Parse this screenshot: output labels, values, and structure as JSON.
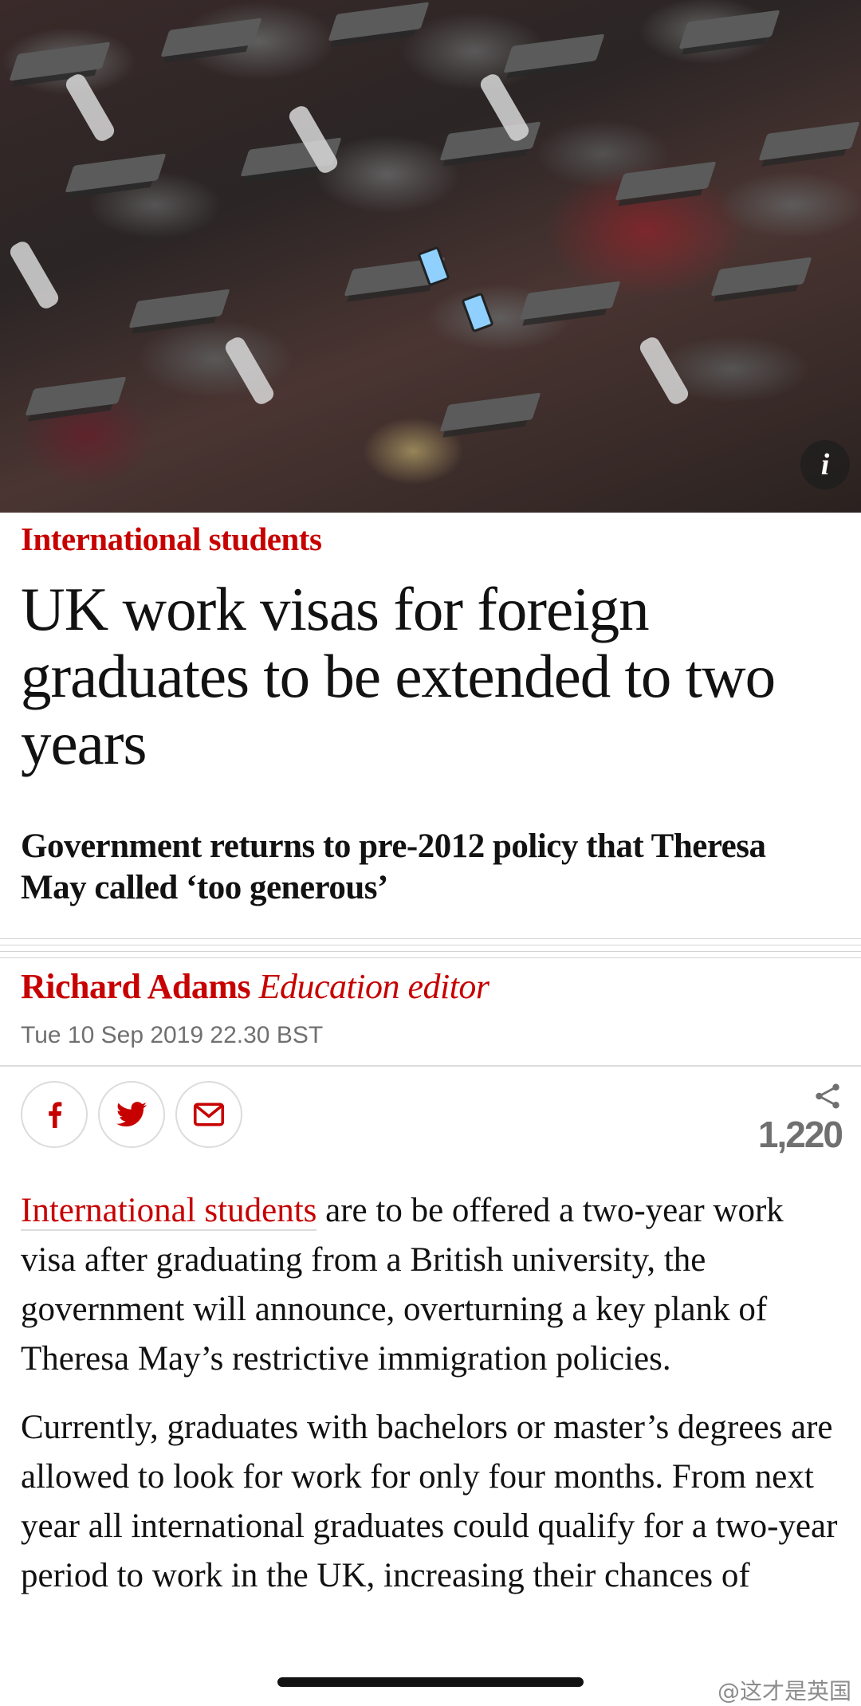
{
  "hero": {
    "info_button_label": "i"
  },
  "article": {
    "section": "International students",
    "headline": "UK work visas for foreign graduates to be extended to two years",
    "standfirst": "Government returns to pre-2012 policy that Theresa May called ‘too generous’",
    "byline": {
      "author": "Richard Adams",
      "role": "Education editor"
    },
    "dateline": "Tue 10 Sep 2019 22.30 BST",
    "share_count": "1,220",
    "paragraphs": [
      {
        "link": "International students",
        "text": " are to be offered a two-year work visa after graduating from a British university, the government will announce, overturning a key plank of Theresa May’s restrictive immigration policies."
      },
      {
        "text": "Currently, graduates with bachelors or master’s degrees are allowed to look for work for only four months. From next year all international graduates could qualify for a two-year period to work in the UK, increasing their chances of"
      }
    ]
  },
  "share_buttons": {
    "facebook_icon": "facebook-icon",
    "twitter_icon": "twitter-icon",
    "email_icon": "email-icon"
  },
  "watermark": "@这才是英国",
  "colors": {
    "accent": "#c70000",
    "text": "#121212",
    "muted": "#707070",
    "rule": "#dcdcdc"
  }
}
